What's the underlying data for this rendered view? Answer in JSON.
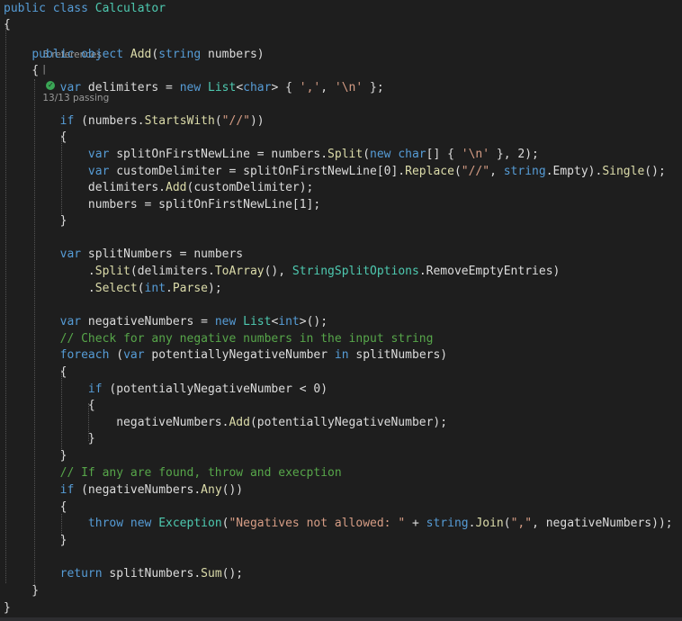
{
  "code_lens": {
    "references": "5 references",
    "separator": "|",
    "tests": "13/13 passing"
  },
  "colors": {
    "keyword": "#569cd6",
    "type": "#4ec9b0",
    "method": "#dcdcaa",
    "string": "#d69d85",
    "comment": "#57a64a",
    "plain": "#dcdcdc",
    "identifier": "#dcdcdc"
  },
  "lines": [
    [
      [
        "kw",
        "public class "
      ],
      [
        "ty",
        "Calculator"
      ]
    ],
    [
      [
        "p",
        "{"
      ]
    ],
    null,
    [
      [
        "p",
        "    "
      ],
      [
        "kw",
        "public object "
      ],
      [
        "me",
        "Add"
      ],
      [
        "p",
        "("
      ],
      [
        "kw",
        "string"
      ],
      [
        "p",
        " numbers)"
      ]
    ],
    [
      [
        "p",
        "    {"
      ]
    ],
    [
      [
        "p",
        "        "
      ],
      [
        "kw",
        "var"
      ],
      [
        "p",
        " delimiters = "
      ],
      [
        "kw",
        "new "
      ],
      [
        "ty",
        "List"
      ],
      [
        "p",
        "<"
      ],
      [
        "kw",
        "char"
      ],
      [
        "p",
        "> { "
      ],
      [
        "st",
        "','"
      ],
      [
        "p",
        ", "
      ],
      [
        "st",
        "'\\n'"
      ],
      [
        "p",
        " };"
      ]
    ],
    [],
    [
      [
        "p",
        "        "
      ],
      [
        "kw",
        "if"
      ],
      [
        "p",
        " (numbers."
      ],
      [
        "me",
        "StartsWith"
      ],
      [
        "p",
        "("
      ],
      [
        "st",
        "\"//\""
      ],
      [
        "p",
        "))"
      ]
    ],
    [
      [
        "p",
        "        {"
      ]
    ],
    [
      [
        "p",
        "            "
      ],
      [
        "kw",
        "var"
      ],
      [
        "p",
        " splitOnFirstNewLine = numbers."
      ],
      [
        "me",
        "Split"
      ],
      [
        "p",
        "("
      ],
      [
        "kw",
        "new char"
      ],
      [
        "p",
        "[] { "
      ],
      [
        "st",
        "'\\n'"
      ],
      [
        "p",
        " }, 2);"
      ]
    ],
    [
      [
        "p",
        "            "
      ],
      [
        "kw",
        "var"
      ],
      [
        "p",
        " customDelimiter = splitOnFirstNewLine[0]."
      ],
      [
        "me",
        "Replace"
      ],
      [
        "p",
        "("
      ],
      [
        "st",
        "\"//\""
      ],
      [
        "p",
        ", "
      ],
      [
        "kw",
        "string"
      ],
      [
        "p",
        ".Empty)."
      ],
      [
        "me",
        "Single"
      ],
      [
        "p",
        "();"
      ]
    ],
    [
      [
        "p",
        "            delimiters."
      ],
      [
        "me",
        "Add"
      ],
      [
        "p",
        "(customDelimiter);"
      ]
    ],
    [
      [
        "p",
        "            numbers = splitOnFirstNewLine[1];"
      ]
    ],
    [
      [
        "p",
        "        }"
      ]
    ],
    [],
    [
      [
        "p",
        "        "
      ],
      [
        "kw",
        "var"
      ],
      [
        "p",
        " splitNumbers = numbers"
      ]
    ],
    [
      [
        "p",
        "            ."
      ],
      [
        "me",
        "Split"
      ],
      [
        "p",
        "(delimiters."
      ],
      [
        "me",
        "ToArray"
      ],
      [
        "p",
        "(), "
      ],
      [
        "ty",
        "StringSplitOptions"
      ],
      [
        "p",
        ".RemoveEmptyEntries)"
      ]
    ],
    [
      [
        "p",
        "            ."
      ],
      [
        "me",
        "Select"
      ],
      [
        "p",
        "("
      ],
      [
        "kw",
        "int"
      ],
      [
        "p",
        "."
      ],
      [
        "me",
        "Parse"
      ],
      [
        "p",
        ");"
      ]
    ],
    [],
    [
      [
        "p",
        "        "
      ],
      [
        "kw",
        "var"
      ],
      [
        "p",
        " negativeNumbers = "
      ],
      [
        "kw",
        "new "
      ],
      [
        "ty",
        "List"
      ],
      [
        "p",
        "<"
      ],
      [
        "kw",
        "int"
      ],
      [
        "p",
        ">();"
      ]
    ],
    [
      [
        "p",
        "        "
      ],
      [
        "co",
        "// Check for any negative numbers in the input string"
      ]
    ],
    [
      [
        "p",
        "        "
      ],
      [
        "kw",
        "foreach"
      ],
      [
        "p",
        " ("
      ],
      [
        "kw",
        "var"
      ],
      [
        "p",
        " potentiallyNegativeNumber "
      ],
      [
        "kw",
        "in"
      ],
      [
        "p",
        " splitNumbers)"
      ]
    ],
    [
      [
        "p",
        "        {"
      ]
    ],
    [
      [
        "p",
        "            "
      ],
      [
        "kw",
        "if"
      ],
      [
        "p",
        " (potentiallyNegativeNumber < 0)"
      ]
    ],
    [
      [
        "p",
        "            {"
      ]
    ],
    [
      [
        "p",
        "                negativeNumbers."
      ],
      [
        "me",
        "Add"
      ],
      [
        "p",
        "(potentiallyNegativeNumber);"
      ]
    ],
    [
      [
        "p",
        "            }"
      ]
    ],
    [
      [
        "p",
        "        }"
      ]
    ],
    [
      [
        "p",
        "        "
      ],
      [
        "co",
        "// If any are found, throw and execption"
      ]
    ],
    [
      [
        "p",
        "        "
      ],
      [
        "kw",
        "if"
      ],
      [
        "p",
        " (negativeNumbers."
      ],
      [
        "me",
        "Any"
      ],
      [
        "p",
        "())"
      ]
    ],
    [
      [
        "p",
        "        {"
      ]
    ],
    [
      [
        "p",
        "            "
      ],
      [
        "kw",
        "throw new "
      ],
      [
        "ty",
        "Exception"
      ],
      [
        "p",
        "("
      ],
      [
        "st",
        "\"Negatives not allowed: \""
      ],
      [
        "p",
        " + "
      ],
      [
        "kw",
        "string"
      ],
      [
        "p",
        "."
      ],
      [
        "me",
        "Join"
      ],
      [
        "p",
        "("
      ],
      [
        "st",
        "\",\""
      ],
      [
        "p",
        ", negativeNumbers));"
      ]
    ],
    [
      [
        "p",
        "        }"
      ]
    ],
    [],
    [
      [
        "p",
        "        "
      ],
      [
        "kw",
        "return"
      ],
      [
        "p",
        " splitNumbers."
      ],
      [
        "me",
        "Sum"
      ],
      [
        "p",
        "();"
      ]
    ],
    [
      [
        "p",
        "    }"
      ]
    ],
    [
      [
        "p",
        "}"
      ]
    ]
  ]
}
